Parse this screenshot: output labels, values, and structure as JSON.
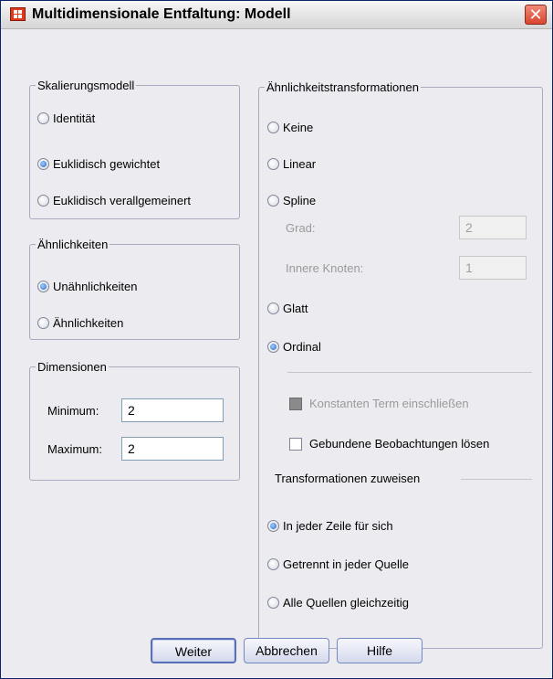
{
  "window": {
    "title": "Multidimensionale Entfaltung: Modell",
    "close_label": "✕"
  },
  "scaling_model": {
    "legend": "Skalierungsmodell",
    "options": [
      {
        "label": "Identität",
        "selected": false
      },
      {
        "label": "Euklidisch gewichtet",
        "selected": true
      },
      {
        "label": "Euklidisch verallgemeinert",
        "selected": false
      }
    ]
  },
  "similarities": {
    "legend": "Ähnlichkeiten",
    "options": [
      {
        "label": "Unähnlichkeiten",
        "selected": true
      },
      {
        "label": "Ähnlichkeiten",
        "selected": false
      }
    ]
  },
  "dimensions": {
    "legend": "Dimensionen",
    "minimum_label": "Minimum:",
    "minimum_value": "2",
    "maximum_label": "Maximum:",
    "maximum_value": "2"
  },
  "similarity_transformations": {
    "legend": "Ähnlichkeitstransformationen",
    "none_label": "Keine",
    "linear_label": "Linear",
    "spline_label": "Spline",
    "degree_label": "Grad:",
    "degree_value": "2",
    "interior_knots_label": "Innere Knoten:",
    "interior_knots_value": "1",
    "smooth_label": "Glatt",
    "ordinal_label": "Ordinal",
    "selected": "Ordinal",
    "include_intercept_label": "Konstanten Term einschließen",
    "untie_label": "Gebundene Beobachtungen lösen",
    "assign_heading": "Transformationen zuweisen",
    "assign_options": [
      {
        "label": "In jeder Zeile für sich",
        "selected": true
      },
      {
        "label": "Getrennt in jeder Quelle",
        "selected": false
      },
      {
        "label": "Alle Quellen gleichzeitig",
        "selected": false
      }
    ]
  },
  "buttons": {
    "continue": "Weiter",
    "cancel": "Abbrechen",
    "help": "Hilfe"
  }
}
